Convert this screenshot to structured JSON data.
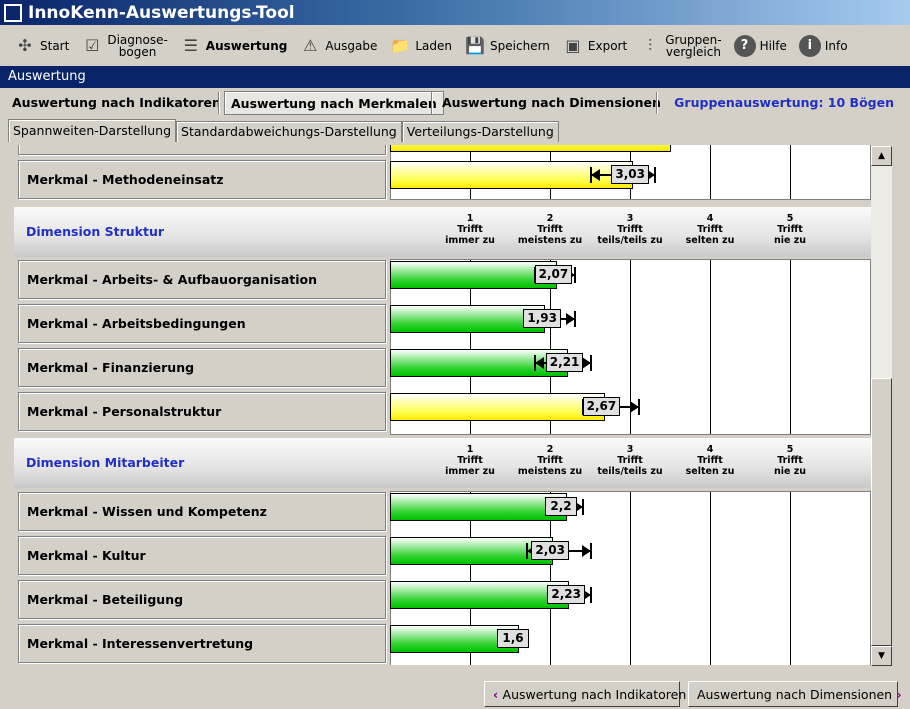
{
  "app": {
    "title": "InnoKenn-Auswertungs-Tool"
  },
  "toolbar": [
    {
      "label": "Start",
      "icon": "arrows-in-icon"
    },
    {
      "label": "Diagnose-\nbogen",
      "icon": "checkbox-icon"
    },
    {
      "label": "Auswertung",
      "icon": "bars-icon",
      "active": true
    },
    {
      "label": "Ausgabe",
      "icon": "acrobat-icon"
    },
    {
      "label": "Laden",
      "icon": "folder-icon"
    },
    {
      "label": "Speichern",
      "icon": "floppy-icon"
    },
    {
      "label": "Export",
      "icon": "csv-icon"
    },
    {
      "label": "Gruppen-\nvergleich",
      "icon": "compare-icon"
    },
    {
      "label": "Hilfe",
      "icon": "help-icon"
    },
    {
      "label": "Info",
      "icon": "info-icon"
    }
  ],
  "section_title": "Auswertung",
  "nav": {
    "by_indicators": "Auswertung nach Indikatoren",
    "by_features": "Auswertung nach Merkmalen",
    "by_dimensions": "Auswertung nach Dimensionen",
    "group_info": "Gruppenauswertung: 10 Bögen"
  },
  "tabs": [
    "Spannweiten-Darstellung",
    "Standardabweichungs-Darstellung",
    "Verteilungs-Darstellung"
  ],
  "colors": {
    "below_threshold": "#00c000",
    "above_threshold": "#ffe800",
    "dimension_title": "#2030c0",
    "header": "#0a246a"
  },
  "chart_data": {
    "type": "bar",
    "orientation": "horizontal",
    "xlim": [
      0,
      6
    ],
    "scale": [
      {
        "value": "1",
        "line1": "Trifft",
        "line2": "immer zu"
      },
      {
        "value": "2",
        "line1": "Trifft",
        "line2": "meistens zu"
      },
      {
        "value": "3",
        "line1": "Trifft",
        "line2": "teils/teils zu"
      },
      {
        "value": "4",
        "line1": "Trifft",
        "line2": "selten zu"
      },
      {
        "value": "5",
        "line1": "Trifft",
        "line2": "nie zu"
      }
    ],
    "partial_top": {
      "value": 3.5,
      "color": "yellow"
    },
    "groups": [
      {
        "title": "",
        "rows": [
          {
            "label": "Merkmal - Methodeneinsatz",
            "value": 3.03,
            "display": "3,03",
            "min": 2.5,
            "max": 3.3,
            "color": "yellow"
          }
        ]
      },
      {
        "title": "Dimension Struktur",
        "rows": [
          {
            "label": "Merkmal - Arbeits- & Aufbauorganisation",
            "value": 2.07,
            "display": "2,07",
            "min": 1.8,
            "max": 2.3,
            "color": "green"
          },
          {
            "label": "Merkmal - Arbeitsbedingungen",
            "value": 1.93,
            "display": "1,93",
            "min": 1.7,
            "max": 2.3,
            "color": "green"
          },
          {
            "label": "Merkmal - Finanzierung",
            "value": 2.21,
            "display": "2,21",
            "min": 1.8,
            "max": 2.5,
            "color": "green"
          },
          {
            "label": "Merkmal - Personalstruktur",
            "value": 2.67,
            "display": "2,67",
            "min": 2.4,
            "max": 3.1,
            "color": "yellow"
          }
        ]
      },
      {
        "title": "Dimension Mitarbeiter",
        "rows": [
          {
            "label": "Merkmal - Wissen und Kompetenz",
            "value": 2.2,
            "display": "2,2",
            "min": null,
            "max": 2.4,
            "color": "green"
          },
          {
            "label": "Merkmal - Kultur",
            "value": 2.03,
            "display": "2,03",
            "min": 1.7,
            "max": 2.5,
            "color": "green"
          },
          {
            "label": "Merkmal - Beteiligung",
            "value": 2.23,
            "display": "2,23",
            "min": null,
            "max": 2.5,
            "color": "green"
          },
          {
            "label": "Merkmal - Interessenvertretung",
            "value": 1.6,
            "display": "1,6",
            "min": null,
            "max": null,
            "color": "green"
          }
        ]
      }
    ]
  },
  "footer": {
    "prev": "Auswertung nach Indikatoren",
    "next": "Auswertung nach Dimensionen"
  }
}
